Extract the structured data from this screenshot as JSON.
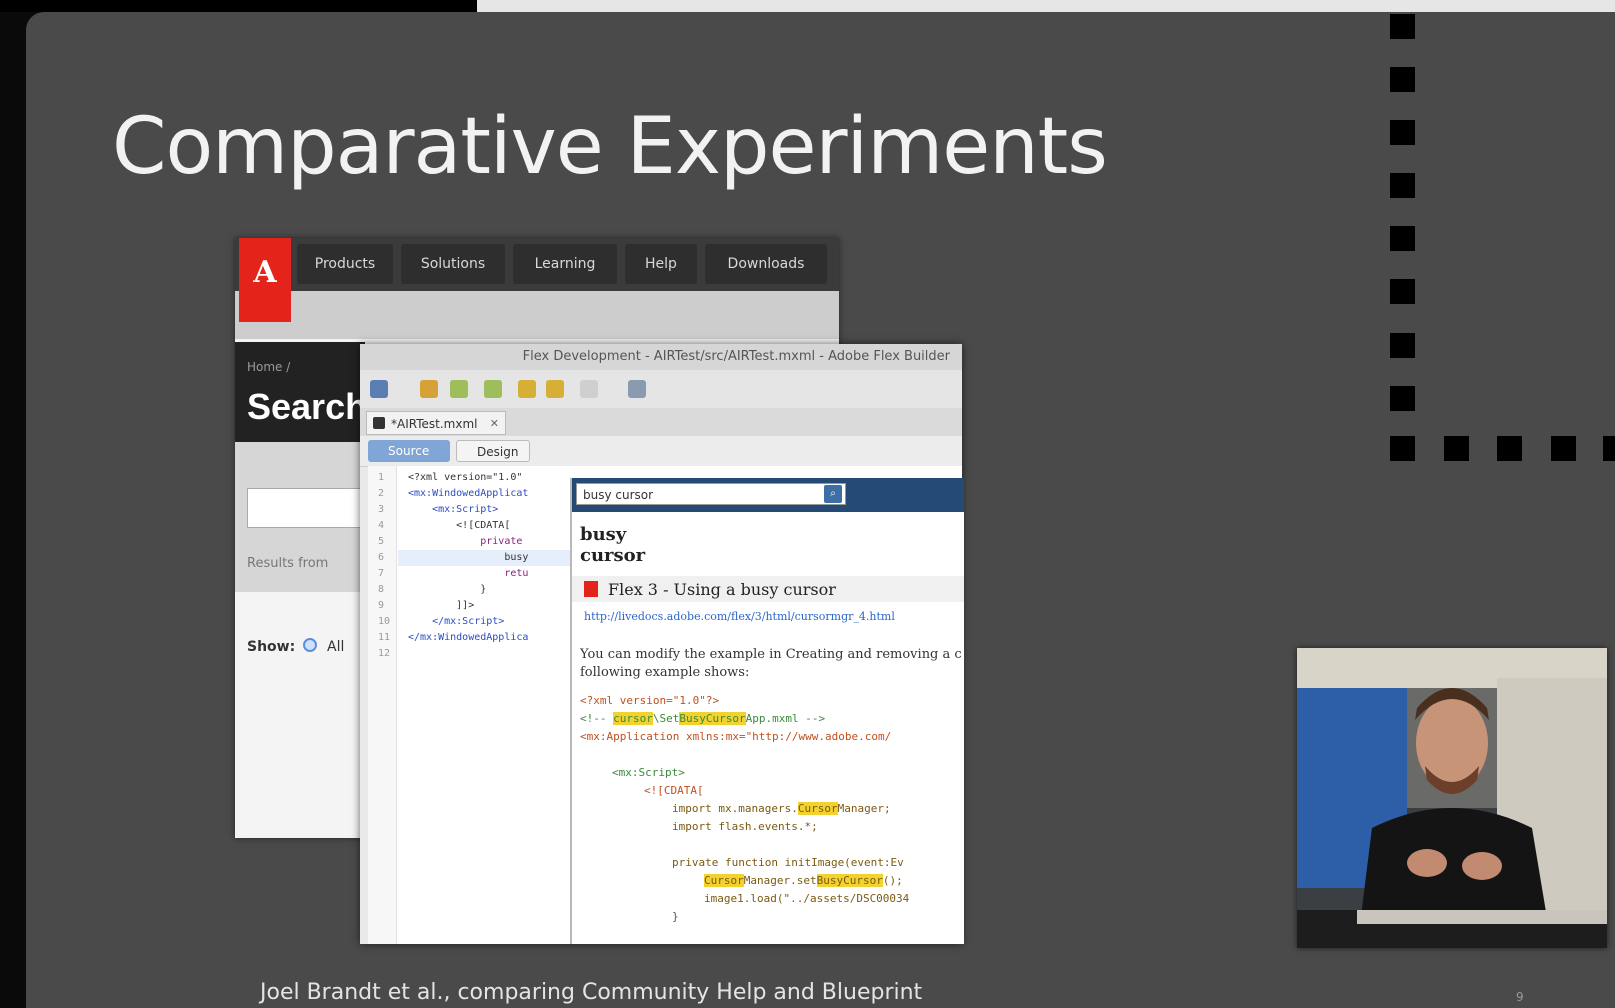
{
  "slide": {
    "title": "Comparative Experiments",
    "caption": "Joel Brandt et al., comparing Community Help and Blueprint",
    "page_number": "9"
  },
  "adobe_site": {
    "logo_text": "A",
    "nav": [
      "Products",
      "Solutions",
      "Learning",
      "Help",
      "Downloads"
    ],
    "breadcrumb": "Home /",
    "heading": "Search",
    "results_label": "Results from",
    "show_label": "Show:",
    "all_label": "All"
  },
  "flex_builder": {
    "window_title": "Flex Development - AIRTest/src/AIRTest.mxml - Adobe Flex Builder",
    "file_tab": "*AIRTest.mxml",
    "source_tab": "Source",
    "design_tab": "Design",
    "line_numbers": [
      "1",
      "2",
      "3",
      "4",
      "5",
      "6",
      "7",
      "8",
      "9",
      "10",
      "11",
      "12"
    ],
    "code_lines": [
      "<?xml version=\"1.0\"",
      "<mx:WindowedApplicat",
      "    <mx:Script>",
      "        <![CDATA[",
      "            private",
      "                busy",
      "                retu",
      "            }",
      "        ]]>",
      "    </mx:Script>",
      "</mx:WindowedApplica",
      ""
    ]
  },
  "blueprint": {
    "search_value": "busy cursor",
    "query_line1": "busy",
    "query_line2": "cursor",
    "result_title": "Flex 3 - Using a busy cursor",
    "result_url": "http://livedocs.adobe.com/flex/3/html/cursormgr_4.html",
    "desc_line1": "You can modify the example in Creating and removing a c",
    "desc_line2": "following example shows:",
    "code_xml": "<?xml version=\"1.0\"?>",
    "code_comment_pre": "<!-- ",
    "code_comment_hl1": "cursor",
    "code_comment_mid": "\\Set",
    "code_comment_hl2": "BusyCursor",
    "code_comment_post": "App.mxml -->",
    "code_app": "<mx:Application xmlns:mx=\"http://www.adobe.com/",
    "code_script": "<mx:Script>",
    "code_cdata": "<![CDATA[",
    "code_import1_pre": "import mx.managers.",
    "code_import1_hl": "Cursor",
    "code_import1_post": "Manager;",
    "code_import2": "import flash.events.*;",
    "code_func": "private function initImage(event:Ev",
    "code_set_hl1": "Cursor",
    "code_set_mid": "Manager.set",
    "code_set_hl2": "BusyCursor",
    "code_set_post": "();",
    "code_load": "image1.load(\"../assets/DSC00034",
    "code_close": "}"
  }
}
